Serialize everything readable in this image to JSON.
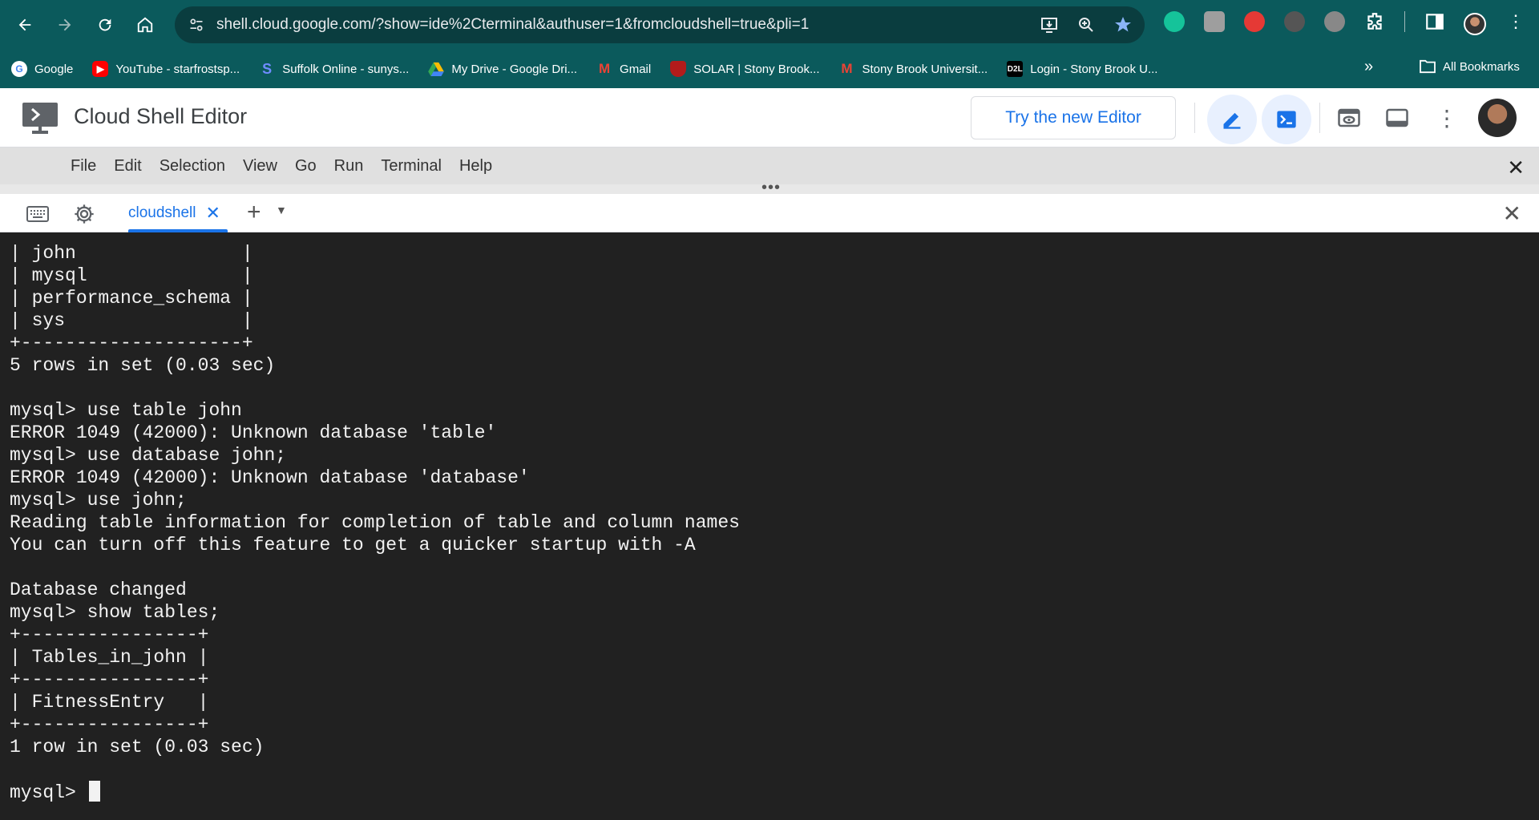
{
  "browser": {
    "url": "shell.cloud.google.com/?show=ide%2Cterminal&authuser=1&fromcloudshell=true&pli=1",
    "bookmarks": [
      {
        "label": "Google",
        "icon": "google-icon",
        "color": "#4285f4"
      },
      {
        "label": "YouTube - starfrostsp...",
        "icon": "youtube-icon",
        "color": "#ff0000"
      },
      {
        "label": "Suffolk Online - sunys...",
        "icon": "suffolk-icon",
        "color": "#2b4bd8"
      },
      {
        "label": "My Drive - Google Dri...",
        "icon": "drive-icon",
        "color": "#34a853"
      },
      {
        "label": "Gmail",
        "icon": "gmail-icon",
        "color": "#ea4335"
      },
      {
        "label": "SOLAR | Stony Brook...",
        "icon": "solar-icon",
        "color": "#b31b1b"
      },
      {
        "label": "Stony Brook Universit...",
        "icon": "gmail-icon",
        "color": "#ea4335"
      },
      {
        "label": "Login - Stony Brook U...",
        "icon": "d2l-icon",
        "color": "#000000"
      }
    ],
    "all_bookmarks_label": "All Bookmarks",
    "more_label": "»"
  },
  "header": {
    "title": "Cloud Shell Editor",
    "try_new_editor": "Try the new Editor"
  },
  "menu": {
    "items": [
      "File",
      "Edit",
      "Selection",
      "View",
      "Go",
      "Run",
      "Terminal",
      "Help"
    ]
  },
  "terminal_tab": {
    "label": "cloudshell",
    "close": "✕",
    "add": "+"
  },
  "terminal": {
    "lines": [
      "| john               |",
      "| mysql              |",
      "| performance_schema |",
      "| sys                |",
      "+--------------------+",
      "5 rows in set (0.03 sec)",
      "",
      "mysql> use table john",
      "ERROR 1049 (42000): Unknown database 'table'",
      "mysql> use database john;",
      "ERROR 1049 (42000): Unknown database 'database'",
      "mysql> use john;",
      "Reading table information for completion of table and column names",
      "You can turn off this feature to get a quicker startup with -A",
      "",
      "Database changed",
      "mysql> show tables;",
      "+----------------+",
      "| Tables_in_john |",
      "+----------------+",
      "| FitnessEntry   |",
      "+----------------+",
      "1 row in set (0.03 sec)",
      "",
      "mysql> "
    ]
  },
  "colors": {
    "browser_bar": "#0b5a5c",
    "accent": "#1a73e8",
    "terminal_bg": "#212121"
  }
}
